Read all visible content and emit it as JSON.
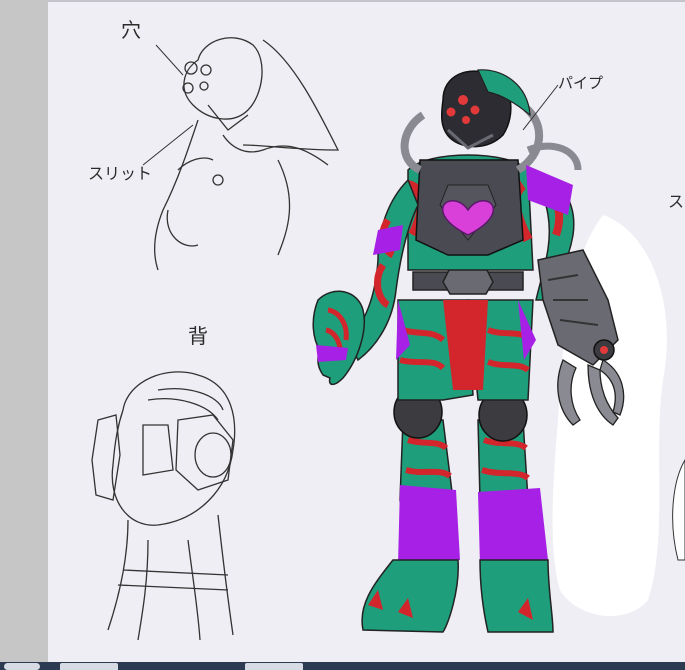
{
  "annotations": {
    "hole": "穴",
    "slit": "スリット",
    "back": "背",
    "pipe": "パイプ",
    "cutoff": "ス"
  },
  "colors": {
    "canvas": "#efeef4",
    "green": "#1f9e7b",
    "red": "#d2262c",
    "purple": "#a620e6",
    "metal": "#4a4a52",
    "magenta": "#d93fd9"
  },
  "icons": {
    "taskbar_buttons": [
      "window-button",
      "window-button",
      "window-button"
    ]
  }
}
